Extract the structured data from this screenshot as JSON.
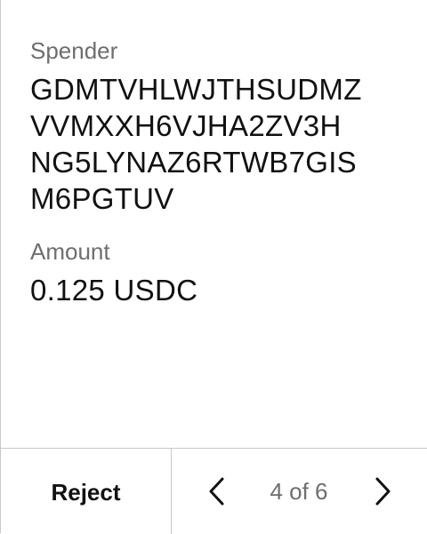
{
  "approval": {
    "spender_label": "Spender",
    "spender_address_lines": [
      "GDMTVHLWJTHSUDMZ",
      "VVMXXH6VJHA2ZV3H",
      "NG5LYNAZ6RTWB7GIS",
      "M6PGTUV"
    ],
    "amount_label": "Amount",
    "amount_value": "0.125 USDC"
  },
  "footer": {
    "reject_label": "Reject",
    "pager_text": "4 of 6",
    "prev_icon": "chevron-left-icon",
    "next_icon": "chevron-right-icon"
  }
}
